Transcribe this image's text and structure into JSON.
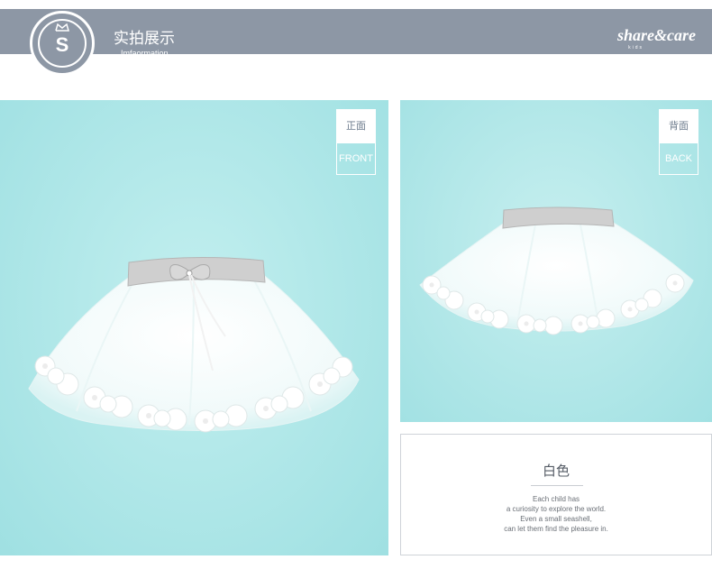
{
  "header": {
    "logo_letter": "S",
    "title_cn": "实拍展示",
    "title_en": "Imfaormation",
    "brand": "share&care",
    "brand_sub": "kids"
  },
  "front_photo": {
    "tag_cn": "正面",
    "tag_en": "FRONT"
  },
  "back_photo": {
    "tag_cn": "背面",
    "tag_en": "BACK"
  },
  "info": {
    "color_name": "白色",
    "description": [
      "Each child has",
      "a curiosity to explore the world.",
      "Even a small seashell,",
      "can let them find the pleasure in."
    ]
  },
  "colors": {
    "header_bg": "#8d97a5",
    "photo_bg": "#b1e8e9",
    "skirt": "#ffffff",
    "waistband": "#c8c8c8"
  }
}
